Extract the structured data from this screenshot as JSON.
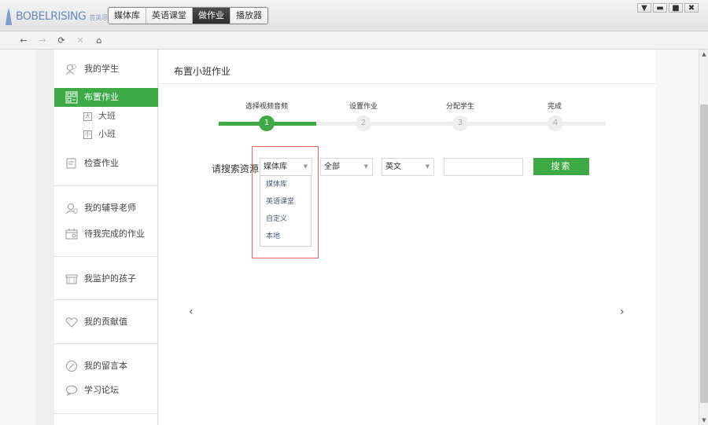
{
  "app": {
    "logo_text": "BOBELRISING",
    "logo_sub": "菩英思益 [体验]"
  },
  "nav": {
    "tabs": [
      {
        "label": "媒体库"
      },
      {
        "label": "英语课堂"
      },
      {
        "label": "做作业",
        "active": true
      },
      {
        "label": "播放器"
      }
    ]
  },
  "window_controls": {
    "menu": "▼",
    "minimize": "▬",
    "maximize": "■",
    "close": "✖"
  },
  "toolbar": {
    "back": "←",
    "forward": "→",
    "refresh": "⟳",
    "stop": "✕",
    "home": "⌂"
  },
  "sidebar": {
    "items": [
      {
        "label": "我的学生",
        "icon": "people-icon"
      },
      {
        "label": "布置作业",
        "icon": "grid-icon",
        "active": true
      },
      {
        "label": "检查作业",
        "icon": "check-doc-icon"
      },
      {
        "label": "我的辅导老师",
        "icon": "teacher-icon"
      },
      {
        "label": "待我完成的作业",
        "icon": "calendar-icon"
      },
      {
        "label": "我监护的孩子",
        "icon": "shop-icon"
      },
      {
        "label": "我的贡献值",
        "icon": "heart-icon"
      },
      {
        "label": "我的留言本",
        "icon": "pencil-icon"
      },
      {
        "label": "学习论坛",
        "icon": "chat-icon"
      }
    ],
    "subitems": [
      {
        "label": "大班",
        "glyph": "大"
      },
      {
        "label": "小班",
        "glyph": "小"
      }
    ]
  },
  "main": {
    "title": "布置小班作业",
    "steps": [
      {
        "label": "选择视频音频",
        "number": "1",
        "done": true
      },
      {
        "label": "设置作业",
        "number": "2"
      },
      {
        "label": "分配学生",
        "number": "3"
      },
      {
        "label": "完成",
        "number": "4"
      }
    ],
    "search": {
      "label": "请搜索资源：",
      "source_select": "媒体库",
      "scope_select": "全部",
      "language_select": "英文",
      "keyword_value": "",
      "button_label": "搜索",
      "source_options": [
        "媒体库",
        "英语课堂",
        "自定义",
        "本地"
      ]
    },
    "prev_arrow": "‹",
    "next_arrow": "›"
  },
  "scrollbar": {
    "up": "▲",
    "down": "▼"
  },
  "colors": {
    "accent": "#3daa46",
    "highlight": "#e06464"
  }
}
